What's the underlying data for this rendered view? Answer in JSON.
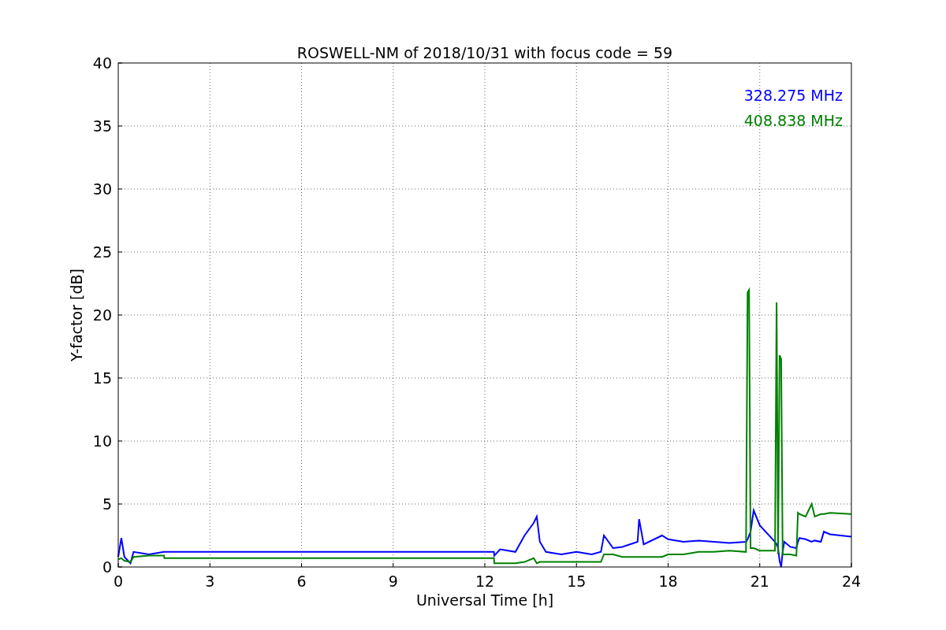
{
  "chart_data": {
    "type": "line",
    "title": "ROSWELL-NM of 2018/10/31 with focus code = 59",
    "xlabel": "Universal Time [h]",
    "ylabel": "Y-factor [dB]",
    "x": [
      0,
      0.1,
      0.2,
      0.4,
      0.5,
      1.0,
      1.5,
      1.51,
      12.3,
      12.31,
      12.5,
      13,
      13.3,
      13.6,
      13.7,
      13.8,
      14,
      14.5,
      15,
      15.5,
      15.8,
      15.9,
      16.2,
      16.5,
      17,
      17.05,
      17.2,
      17.8,
      18,
      18.5,
      19,
      19.5,
      20,
      20.55,
      20.6,
      20.65,
      20.7,
      20.8,
      21,
      21.5,
      21.55,
      21.6,
      21.65,
      21.7,
      21.75,
      21.8,
      22,
      22.2,
      22.25,
      22.3,
      22.5,
      22.7,
      22.8,
      23,
      23.1,
      23.3,
      24
    ],
    "series": [
      {
        "name": "328.275 MHz",
        "color": "#0000ff",
        "values": [
          0.8,
          2.3,
          0.8,
          0.3,
          1.2,
          1.0,
          1.2,
          1.2,
          1.2,
          0.9,
          1.4,
          1.2,
          2.5,
          3.5,
          4.0,
          2.0,
          1.2,
          1.0,
          1.2,
          1.0,
          1.2,
          2.5,
          1.5,
          1.6,
          2.0,
          3.8,
          1.8,
          2.5,
          2.2,
          2.0,
          2.1,
          2.0,
          1.9,
          2.0,
          2.2,
          2.5,
          2.8,
          4.5,
          3.3,
          2.0,
          1.8,
          1.5,
          0.5,
          0.0,
          1.2,
          2.0,
          1.6,
          1.5,
          2.0,
          2.3,
          2.2,
          2.0,
          2.1,
          2.0,
          2.8,
          2.6,
          2.4
        ]
      },
      {
        "name": "408.838 MHz",
        "color": "#008000",
        "values": [
          0.6,
          0.7,
          0.5,
          0.4,
          0.8,
          0.9,
          0.9,
          0.7,
          0.7,
          0.3,
          0.3,
          0.3,
          0.4,
          0.7,
          0.3,
          0.4,
          0.4,
          0.4,
          0.4,
          0.4,
          0.4,
          1.0,
          1.0,
          0.8,
          0.8,
          0.8,
          0.8,
          0.8,
          1.0,
          1.0,
          1.2,
          1.2,
          1.3,
          1.2,
          21.8,
          22.0,
          1.5,
          1.5,
          1.3,
          1.3,
          21.0,
          1.0,
          16.8,
          16.5,
          1.0,
          1.0,
          1.0,
          0.9,
          4.3,
          4.2,
          4.0,
          5.0,
          4.0,
          4.2,
          4.2,
          4.3,
          4.2
        ]
      }
    ],
    "grid": true,
    "xlim": [
      0,
      24
    ],
    "ylim": [
      0,
      40
    ],
    "xticks": [
      0,
      3,
      6,
      9,
      12,
      15,
      18,
      21,
      24
    ],
    "yticks": [
      0,
      5,
      10,
      15,
      20,
      25,
      30,
      35,
      40
    ]
  }
}
